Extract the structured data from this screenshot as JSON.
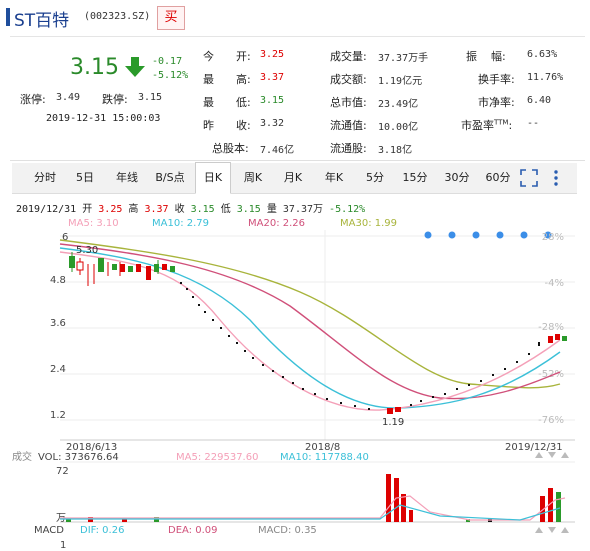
{
  "header": {
    "name": "ST百特",
    "code": "(002323.SZ)",
    "buy_label": "买"
  },
  "quote": {
    "price": "3.15",
    "change": "-0.17",
    "change_pct": "-5.12%",
    "limit_up_label": "涨停:",
    "limit_up": "3.49",
    "limit_down_label": "跌停:",
    "limit_down": "3.15",
    "datetime": "2019-12-31  15:00:03"
  },
  "stats": {
    "today_label": "今",
    "yest_label": "昨",
    "high_label": "最",
    "low_label": "最",
    "open_label": "开:",
    "open": "3.25",
    "high_label2": "高:",
    "high": "3.37",
    "low_label2": "低:",
    "low": "3.15",
    "close_label": "收:",
    "prev_close": "3.32",
    "total_shares_label": "总股本:",
    "total_shares": "7.46亿",
    "volume_label": "成交量:",
    "volume": "37.37万手",
    "turnover_label": "成交额:",
    "turnover": "1.19亿元",
    "mktcap_label": "总市值:",
    "mktcap": "23.49亿",
    "float_cap_label": "流通值:",
    "float_cap": "10.00亿",
    "float_shares_label": "流通股:",
    "float_shares": "3.18亿",
    "amplitude_label": "振    幅:",
    "amplitude": "6.63%",
    "turnover_rate_label": "换手率:",
    "turnover_rate": "11.76%",
    "pb_label": "市净率:",
    "pb": "6.40",
    "pe_label": "市盈率",
    "pe_sup": "TTM",
    "pe_colon": ":",
    "pe": "--"
  },
  "tabs": [
    "分时",
    "5日",
    "年线",
    "B/S点",
    "日K",
    "周K",
    "月K",
    "年K",
    "5分",
    "15分",
    "30分",
    "60分"
  ],
  "active_tab": "日K",
  "kline_info": {
    "date": "2019/12/31",
    "open_label": "开",
    "open": "3.25",
    "high_label": "高",
    "high": "3.37",
    "close_label": "收",
    "close": "3.15",
    "low_label": "低",
    "low": "3.15",
    "vol_label": "量",
    "vol": "37.37万",
    "pct": "-5.12%"
  },
  "ma": {
    "ma5": "MA5: 3.10",
    "ma10": "MA10: 2.79",
    "ma20": "MA20: 2.26",
    "ma30": "MA30: 1.99"
  },
  "colors": {
    "ma5": "#f4a0b8",
    "ma10": "#3cc0d8",
    "ma20": "#d0507a",
    "ma30": "#a8b43c",
    "up": "#d00000",
    "down": "#2a9a2a",
    "accent": "#1f4e9c"
  },
  "axis": {
    "y_left": [
      "6",
      "4.8",
      "3.6",
      "2.4",
      "1.2"
    ],
    "y_right": [
      "28%",
      "-4%",
      "-28%",
      "-52%",
      "-76%"
    ],
    "x": [
      "2018/6/13",
      "2018/8",
      "2019/12/31"
    ],
    "label_high": "5.30",
    "label_low": "1.19"
  },
  "volume_panel": {
    "label": "成交",
    "vol": "VOL: 373676.64",
    "ma5": "MA5: 229537.60",
    "ma10": "MA10: 117788.40",
    "y_top": "72",
    "y_unit": "万"
  },
  "macd_panel": {
    "label": "MACD",
    "dif": "DIF: 0.26",
    "dea": "DEA: 0.09",
    "macd": "MACD: 0.35",
    "y_bottom": "1"
  },
  "chart_data": {
    "type": "line",
    "series": [
      {
        "name": "MA5",
        "last": 3.1
      },
      {
        "name": "MA10",
        "last": 2.79
      },
      {
        "name": "MA20",
        "last": 2.26
      },
      {
        "name": "MA30",
        "last": 1.99
      }
    ],
    "ylim": [
      0.8,
      6.2
    ],
    "x": [
      "2018/6/13",
      "2018/8",
      "2019/12/31"
    ],
    "price_path": [
      {
        "x": "2018/6/13",
        "close": 5.3
      },
      {
        "x": "2018/8",
        "close": 2.3
      },
      {
        "x": "2018/10",
        "close": 1.19
      },
      {
        "x": "2019/12/31",
        "close": 3.15
      }
    ]
  }
}
